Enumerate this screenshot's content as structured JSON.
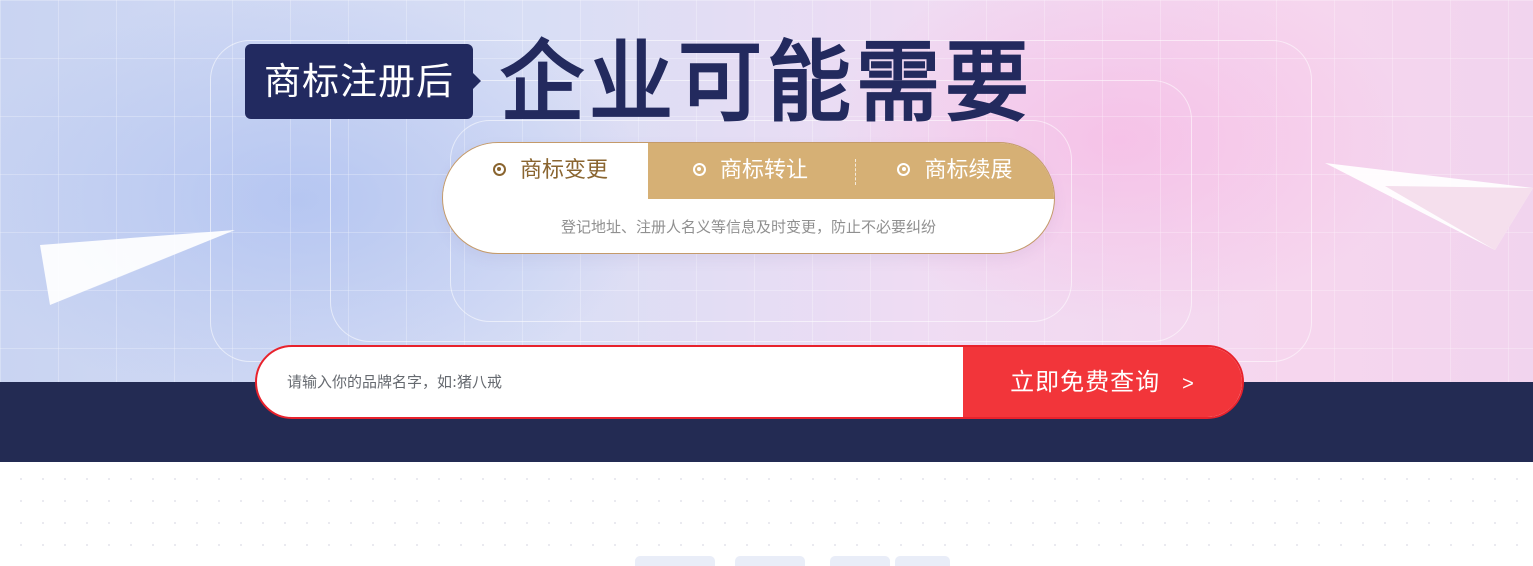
{
  "hero": {
    "badge": "商标注册后",
    "headline": "企业可能需要"
  },
  "tabs": {
    "items": [
      {
        "label": "商标变更",
        "active": true
      },
      {
        "label": "商标转让",
        "active": false
      },
      {
        "label": "商标续展",
        "active": false
      }
    ],
    "description": "登记地址、注册人名义等信息及时变更，防止不必要纠纷"
  },
  "search": {
    "placeholder": "请输入你的品牌名字，如:猪八戒",
    "button_label": "立即免费查询",
    "button_arrow": ">"
  },
  "colors": {
    "navy": "#232b53",
    "gold": "#d6b075",
    "red": "#f2353a"
  },
  "icons": {
    "tab_marker": "radio-ring-icon",
    "search_arrow": "chevron-right-icon"
  }
}
